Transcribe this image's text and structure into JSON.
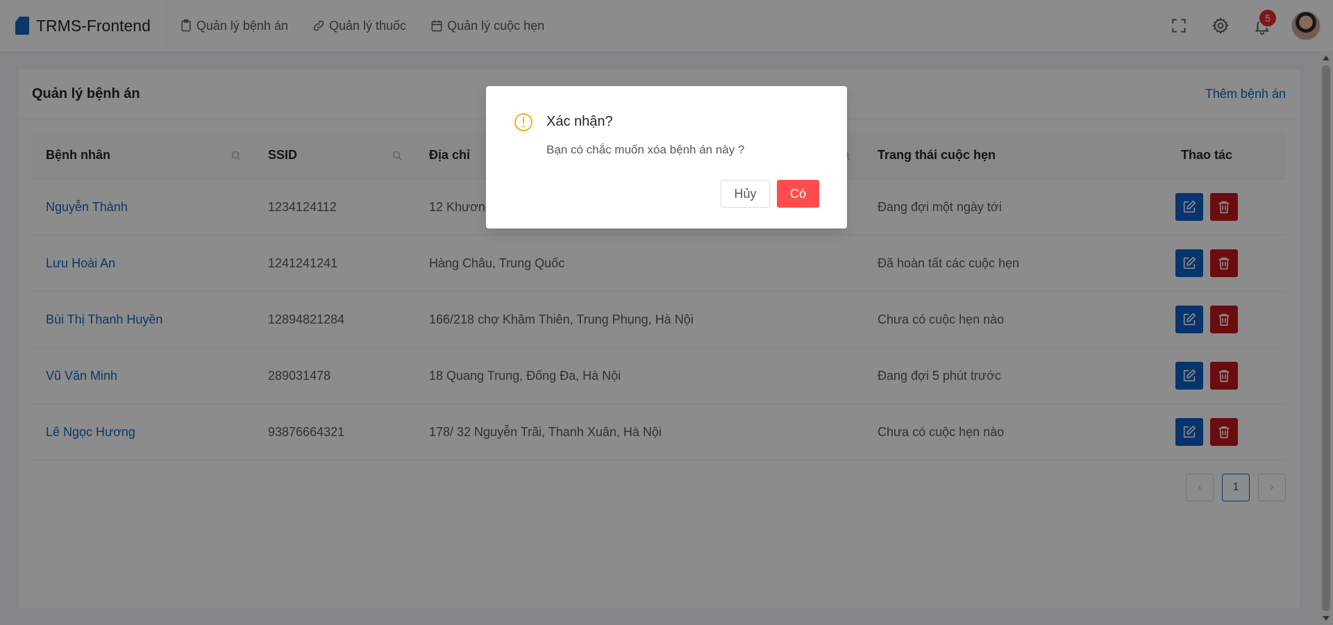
{
  "header": {
    "brand": "TRMS-Frontend",
    "nav": [
      {
        "label": "Quản lý bệnh án",
        "icon": "clipboard-icon"
      },
      {
        "label": "Quản lý thuốc",
        "icon": "link-icon"
      },
      {
        "label": "Quản lý cuộc hẹn",
        "icon": "calendar-icon"
      }
    ],
    "notifications_count": "5"
  },
  "card": {
    "title": "Quản lý bệnh án",
    "add_link": "Thêm bệnh án"
  },
  "table": {
    "columns": [
      "Bệnh nhân",
      "SSID",
      "Địa chỉ",
      "Trang thái cuộc hẹn",
      "Thao tác"
    ],
    "rows": [
      {
        "name": "Nguyễn Thành",
        "ssid": "1234124112",
        "address": "12 Khương",
        "status": "Đang đợi một ngày tới"
      },
      {
        "name": "Lưu Hoài An",
        "ssid": "1241241241",
        "address": "Hàng Châu, Trung Quốc",
        "status": "Đã hoàn tất các cuộc hẹn"
      },
      {
        "name": "Bùi Thị Thanh Huyền",
        "ssid": "12894821284",
        "address": "166/218 chợ Khâm Thiên, Trung Phụng, Hà Nội",
        "status": "Chưa có cuộc hẹn nào"
      },
      {
        "name": "Vũ Văn Minh",
        "ssid": "289031478",
        "address": "18 Quang Trung, Đống Đa, Hà Nội",
        "status": "Đang đợi 5 phút trước"
      },
      {
        "name": "Lê Ngọc Hương",
        "ssid": "93876664321",
        "address": "178/ 32 Nguyễn Trãi, Thanh Xuân, Hà Nội",
        "status": "Chưa có cuộc hẹn nào"
      }
    ]
  },
  "pagination": {
    "current": "1"
  },
  "modal": {
    "title": "Xác nhận?",
    "message": "Bạn có chắc muốn xóa bệnh án này ?",
    "cancel_label": "Hủy",
    "ok_label": "Có"
  },
  "colors": {
    "primary": "#1565c0",
    "danger": "#c3161d",
    "ok_button": "#ff4d4f",
    "warning": "#faad14",
    "badge": "#e52b2b"
  }
}
